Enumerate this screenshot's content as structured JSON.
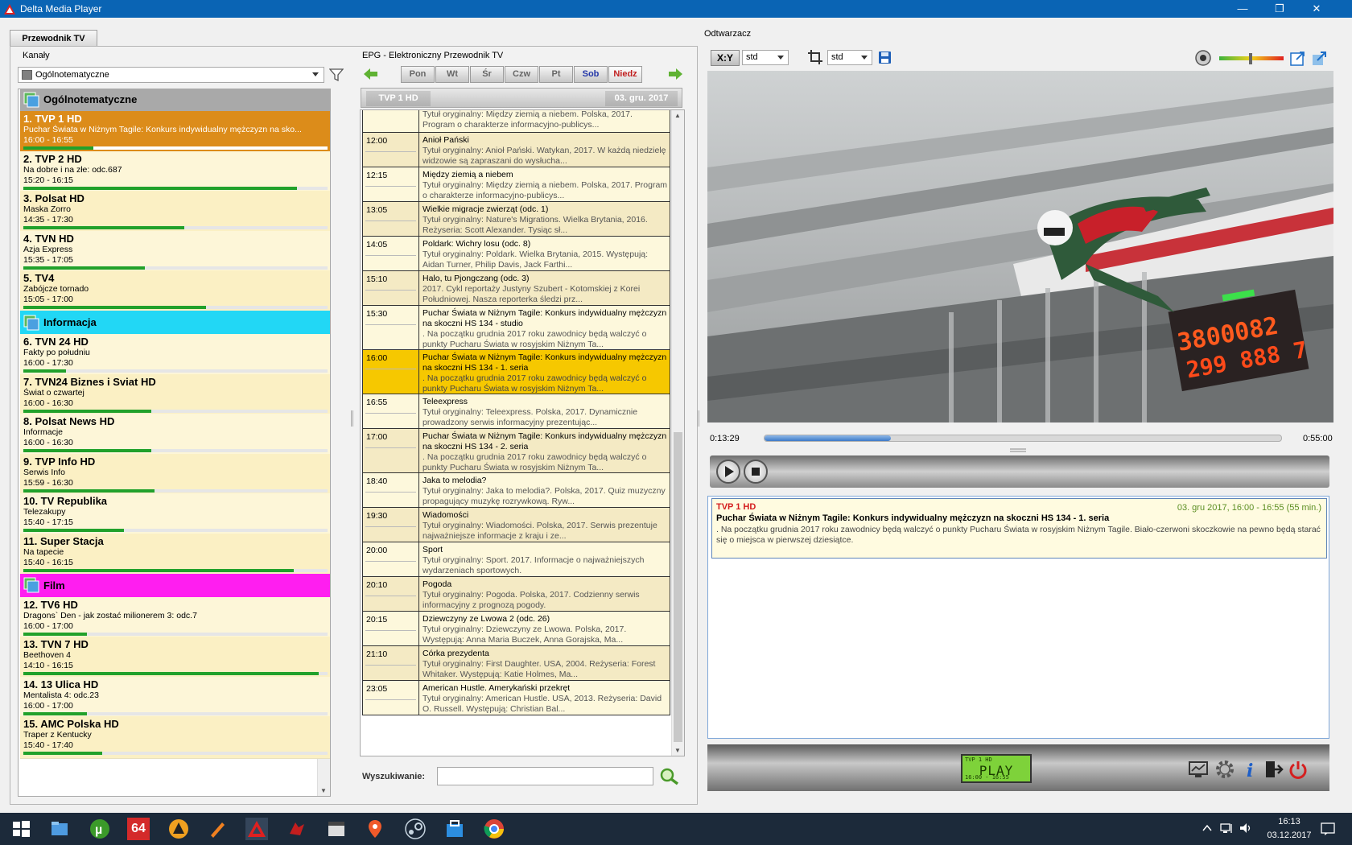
{
  "window": {
    "title": "Delta Media Player",
    "minimize": "—",
    "maximize": "❐",
    "close": "✕"
  },
  "tab": {
    "label": "Przewodnik TV"
  },
  "channels": {
    "label": "Kanały",
    "group_select": "Ogólnotematyczne",
    "categories": [
      {
        "name": "Ogólnotematyczne",
        "color": "#a9a9a9"
      },
      {
        "name": "Informacja",
        "color": "#22d7f5"
      },
      {
        "name": "Film",
        "color": "#ff1ef0"
      }
    ],
    "items": [
      {
        "name": "1. TVP 1 HD",
        "program": "Puchar Świata w Niżnym Tagile: Konkurs indywidualny mężczyzn na sko...",
        "time": "16:00 - 16:55",
        "progress": 0.23
      },
      {
        "name": "2. TVP 2 HD",
        "program": "Na dobre i na złe: odc.687",
        "time": "15:20 - 16:15",
        "progress": 0.9
      },
      {
        "name": "3. Polsat HD",
        "program": "Maska Zorro",
        "time": "14:35 - 17:30",
        "progress": 0.53
      },
      {
        "name": "4. TVN HD",
        "program": "Azja Express",
        "time": "15:35 - 17:05",
        "progress": 0.4
      },
      {
        "name": "5. TV4",
        "program": "Zabójcze tornado",
        "time": "15:05 - 17:00",
        "progress": 0.6
      },
      {
        "name": "6. TVN 24 HD",
        "program": "Fakty po południu",
        "time": "16:00 - 17:30",
        "progress": 0.14
      },
      {
        "name": "7. TVN24 Biznes i Sviat HD",
        "program": "Świat o czwartej",
        "time": "16:00 - 16:30",
        "progress": 0.42
      },
      {
        "name": "8. Polsat News HD",
        "program": "Informacje",
        "time": "16:00 - 16:30",
        "progress": 0.42
      },
      {
        "name": "9. TVP Info HD",
        "program": "Serwis Info",
        "time": "15:59 - 16:30",
        "progress": 0.43
      },
      {
        "name": "10. TV Republika",
        "program": "Telezakupy",
        "time": "15:40 - 17:15",
        "progress": 0.33
      },
      {
        "name": "11. Super Stacja",
        "program": "Na tapecie",
        "time": "15:40 - 16:15",
        "progress": 0.89
      },
      {
        "name": "12. TV6 HD",
        "program": "Dragons` Den - jak zostać milionerem 3: odc.7",
        "time": "16:00 - 17:00",
        "progress": 0.21
      },
      {
        "name": "13. TVN 7 HD",
        "program": "Beethoven 4",
        "time": "14:10 - 16:15",
        "progress": 0.97
      },
      {
        "name": "14. 13 Ulica HD",
        "program": "Mentalista 4: odc.23",
        "time": "16:00 - 17:00",
        "progress": 0.21
      },
      {
        "name": "15. AMC Polska HD",
        "program": "Traper z Kentucky",
        "time": "15:40 - 17:40",
        "progress": 0.26
      }
    ]
  },
  "epg": {
    "label": "EPG - Elektroniczny Przewodnik TV",
    "days": [
      "Pon",
      "Wt",
      "Śr",
      "Czw",
      "Pt",
      "Sob",
      "Niedz"
    ],
    "channel": "TVP 1 HD",
    "date": "03. gru. 2017",
    "top_partial": {
      "line1": "Tytuł oryginalny: Między ziemią a niebem. Polska, 2017.",
      "line2": "Program o charakterze informacyjno-publicys..."
    },
    "items": [
      {
        "time": "12:00",
        "title": "Anioł Pański",
        "desc": "Tytuł oryginalny: Anioł Pański. Watykan, 2017.  W każdą niedzielę widzowie są zapraszani do wysłucha..."
      },
      {
        "time": "12:15",
        "title": "Między ziemią a niebem",
        "desc": "Tytuł oryginalny: Między ziemią a niebem. Polska, 2017. Program o charakterze informacyjno-publicys..."
      },
      {
        "time": "13:05",
        "title": "Wielkie migracje zwierząt (odc. 1)",
        "desc": "Tytuł oryginalny: Nature's Migrations. Wielka Brytania, 2016. Reżyseria: Scott Alexander.  Tysiąc sł..."
      },
      {
        "time": "14:05",
        "title": "Poldark: Wichry losu (odc. 8)",
        "desc": "Tytuł oryginalny: Poldark. Wielka Brytania, 2015. Występują: Aidan Turner, Philip Davis, Jack Farthi..."
      },
      {
        "time": "15:10",
        "title": "Halo, tu Pjongczang (odc. 3)",
        "desc": "2017.  Cykl reportaży Justyny Szubert - Kotomskiej z Korei Południowej.  Nasza reporterka śledzi prz..."
      },
      {
        "time": "15:30",
        "title": "Puchar Świata w Niżnym Tagile: Konkurs indywidualny mężczyzn na skoczni HS 134 - studio",
        "desc": ". Na początku grudnia 2017 roku zawodnicy będą walczyć o punkty Pucharu Świata w rosyjskim Niżnym Ta..."
      },
      {
        "time": "16:00",
        "title": "Puchar Świata w Niżnym Tagile: Konkurs indywidualny mężczyzn na skoczni HS 134 - 1. seria",
        "desc": ". Na początku grudnia 2017 roku zawodnicy będą walczyć o punkty Pucharu Świata w rosyjskim Niżnym Ta..."
      },
      {
        "time": "16:55",
        "title": "Teleexpress",
        "desc": "Tytuł oryginalny: Teleexpress. Polska, 2017.  Dynamicznie prowadzony serwis informacyjny prezentując..."
      },
      {
        "time": "17:00",
        "title": "Puchar Świata w Niżnym Tagile: Konkurs indywidualny mężczyzn na skoczni HS 134 - 2. seria",
        "desc": ". Na początku grudnia 2017 roku zawodnicy będą walczyć o punkty Pucharu Świata w rosyjskim Niżnym Ta..."
      },
      {
        "time": "18:40",
        "title": "Jaka to melodia?",
        "desc": "Tytuł oryginalny: Jaka to melodia?. Polska, 2017.  Quiz muzyczny propagujący muzykę rozrywkową.  Ryw..."
      },
      {
        "time": "19:30",
        "title": "Wiadomości",
        "desc": "Tytuł oryginalny: Wiadomości. Polska, 2017.  Serwis prezentuje najważniejsze informacje z kraju i ze..."
      },
      {
        "time": "20:00",
        "title": "Sport",
        "desc": "Tytuł oryginalny: Sport. 2017.  Informacje o najważniejszych wydarzeniach sportowych."
      },
      {
        "time": "20:10",
        "title": "Pogoda",
        "desc": "Tytuł oryginalny: Pogoda. Polska, 2017.  Codzienny serwis informacyjny z prognozą pogody."
      },
      {
        "time": "20:15",
        "title": "Dziewczyny ze Lwowa 2 (odc. 26)",
        "desc": "Tytuł oryginalny: Dziewczyny ze Lwowa. Polska, 2017. Występują: Anna Maria Buczek, Anna Gorajska, Ma..."
      },
      {
        "time": "21:10",
        "title": "Córka prezydenta",
        "desc": "Tytuł oryginalny: First Daughter. USA, 2004. Reżyseria: Forest Whitaker. Występują: Katie Holmes, Ma..."
      },
      {
        "time": "23:05",
        "title": "American Hustle. Amerykański przekręt",
        "desc": "Tytuł oryginalny: American Hustle. USA, 2013. Reżyseria: David O.  Russell. Występują: Christian Bal..."
      }
    ],
    "search_label": "Wyszukiwanie:",
    "search_value": ""
  },
  "player": {
    "label": "Odtwarzacz",
    "aspect_label": "X:Y",
    "aspect_value": "std",
    "crop_value": "std",
    "time_elapsed": "0:13:29",
    "time_total": "0:55:00",
    "progress": 0.245,
    "score1": "3800082",
    "score2": "299 888 7",
    "info": {
      "channel": "TVP 1 HD",
      "date": "03. gru 2017, 16:00 - 16:55 (55 min.)",
      "title": "Puchar Świata w Niżnym Tagile: Konkurs indywidualny mężczyzn na skoczni HS 134 - 1. seria",
      "desc": ". Na początku grudnia 2017 roku zawodnicy będą walczyć o punkty Pucharu Świata w rosyjskim Niżnym Tagile.  Biało-czerwoni skoczkowie na pewno będą starać się o miejsca w pierwszej dziesiątce."
    },
    "lcd": {
      "channel": "TVP 1 HD",
      "status": "PLAY",
      "time": "16:00 - 16:55"
    }
  },
  "taskbar": {
    "time": "16:13",
    "date": "03.12.2017",
    "badge64": "64"
  }
}
